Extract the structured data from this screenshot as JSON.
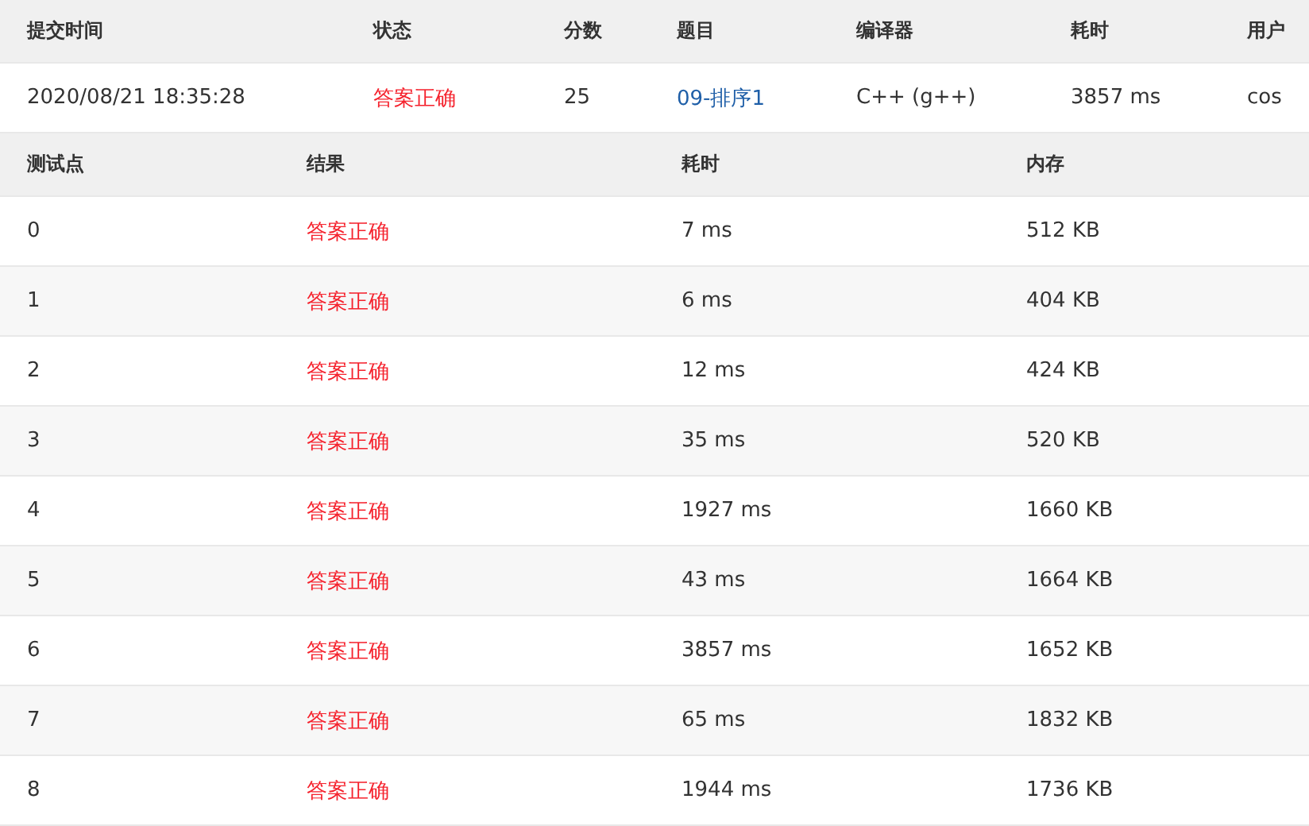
{
  "submission": {
    "columns": [
      "提交时间",
      "状态",
      "分数",
      "题目",
      "编译器",
      "耗时",
      "用户"
    ],
    "row": {
      "time": "2020/08/21 18:35:28",
      "status": "答案正确",
      "score": "25",
      "problem": "09-排序1",
      "compiler": "C++ (g++)",
      "duration": "3857 ms",
      "user": "cos"
    }
  },
  "tests": {
    "columns": [
      "测试点",
      "结果",
      "耗时",
      "内存"
    ],
    "rows": [
      {
        "case": "0",
        "result": "答案正确",
        "time": "7 ms",
        "memory": "512 KB"
      },
      {
        "case": "1",
        "result": "答案正确",
        "time": "6 ms",
        "memory": "404 KB"
      },
      {
        "case": "2",
        "result": "答案正确",
        "time": "12 ms",
        "memory": "424 KB"
      },
      {
        "case": "3",
        "result": "答案正确",
        "time": "35 ms",
        "memory": "520 KB"
      },
      {
        "case": "4",
        "result": "答案正确",
        "time": "1927 ms",
        "memory": "1660 KB"
      },
      {
        "case": "5",
        "result": "答案正确",
        "time": "43 ms",
        "memory": "1664 KB"
      },
      {
        "case": "6",
        "result": "答案正确",
        "time": "3857 ms",
        "memory": "1652 KB"
      },
      {
        "case": "7",
        "result": "答案正确",
        "time": "65 ms",
        "memory": "1832 KB"
      },
      {
        "case": "8",
        "result": "答案正确",
        "time": "1944 ms",
        "memory": "1736 KB"
      }
    ]
  }
}
